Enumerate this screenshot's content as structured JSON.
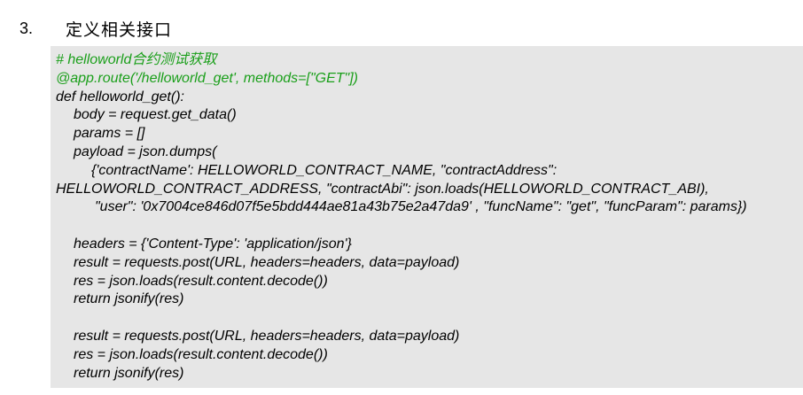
{
  "heading": {
    "number": "3.",
    "title": "定义相关接口"
  },
  "code": {
    "lines": [
      {
        "text": "# helloworld合约测试获取",
        "style": "green",
        "indent": 0
      },
      {
        "text": "@app.route('/helloworld_get', methods=[\"GET\"])",
        "style": "green",
        "indent": 0
      },
      {
        "text": "def helloworld_get():",
        "style": "normal",
        "indent": 0
      },
      {
        "text": "body = request.get_data()",
        "style": "normal",
        "indent": 20
      },
      {
        "text": "params = []",
        "style": "normal",
        "indent": 20
      },
      {
        "text": "payload = json.dumps(",
        "style": "normal",
        "indent": 20
      },
      {
        "text": "{'contractName': HELLOWORLD_CONTRACT_NAME, \"contractAddress\":",
        "style": "normal",
        "indent": 40
      },
      {
        "text": "HELLOWORLD_CONTRACT_ADDRESS, \"contractAbi\": json.loads(HELLOWORLD_CONTRACT_ABI),",
        "style": "normal",
        "indent": 0
      },
      {
        "text": "\"user\": '0x7004ce846d07f5e5bdd444ae81a43b75e2a47da9' , \"funcName\": \"get\", \"funcParam\": params})",
        "style": "normal",
        "indent": 44
      },
      {
        "text": "",
        "style": "blank",
        "indent": 0
      },
      {
        "text": "headers = {'Content-Type': 'application/json'}",
        "style": "normal",
        "indent": 20
      },
      {
        "text": "result = requests.post(URL, headers=headers, data=payload)",
        "style": "normal",
        "indent": 20
      },
      {
        "text": "res = json.loads(result.content.decode())",
        "style": "normal",
        "indent": 20
      },
      {
        "text": "return jsonify(res)",
        "style": "normal",
        "indent": 20
      },
      {
        "text": "",
        "style": "blank",
        "indent": 0
      },
      {
        "text": "result = requests.post(URL, headers=headers, data=payload)",
        "style": "normal",
        "indent": 20
      },
      {
        "text": "res = json.loads(result.content.decode())",
        "style": "normal",
        "indent": 20
      },
      {
        "text": "return jsonify(res)",
        "style": "normal",
        "indent": 20
      }
    ]
  },
  "colors": {
    "code_background": "#e6e6e6",
    "comment_and_decorator": "#1a9f1a",
    "text": "#000000"
  }
}
